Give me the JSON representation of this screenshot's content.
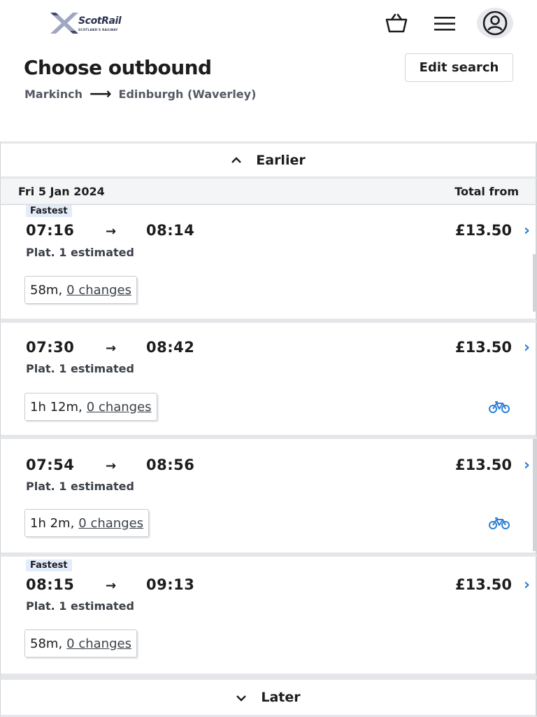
{
  "header": {
    "logo_text": "ScotRail",
    "logo_tagline": "SCOTLAND'S RAILWAY",
    "icons": [
      "basket-icon",
      "menu-icon",
      "account-icon"
    ]
  },
  "title": "Choose outbound",
  "edit_search_label": "Edit search",
  "route": {
    "from": "Markinch",
    "to": "Edinburgh (Waverley)"
  },
  "earlier_label": "Earlier",
  "later_label": "Later",
  "date_bar": {
    "date": "Fri 5 Jan 2024",
    "total_from": "Total from"
  },
  "journeys": [
    {
      "tag": "Fastest",
      "depart": "07:16",
      "arrive": "08:14",
      "price": "£13.50",
      "platform": "Plat. 1 estimated",
      "duration": "58m,",
      "changes": "0 changes",
      "bike": false
    },
    {
      "tag": "",
      "depart": "07:30",
      "arrive": "08:42",
      "price": "£13.50",
      "platform": "Plat. 1 estimated",
      "duration": "1h 12m,",
      "changes": "0 changes",
      "bike": true
    },
    {
      "tag": "",
      "depart": "07:54",
      "arrive": "08:56",
      "price": "£13.50",
      "platform": "Plat. 1 estimated",
      "duration": "1h 2m,",
      "changes": "0 changes",
      "bike": true
    },
    {
      "tag": "Fastest",
      "depart": "08:15",
      "arrive": "09:13",
      "price": "£13.50",
      "platform": "Plat. 1 estimated",
      "duration": "58m,",
      "changes": "0 changes",
      "bike": false
    }
  ],
  "colors": {
    "accent": "#2e7fd6",
    "tag_bg": "#e3ecfa",
    "text": "#1d1d1f",
    "muted": "#545a63"
  }
}
